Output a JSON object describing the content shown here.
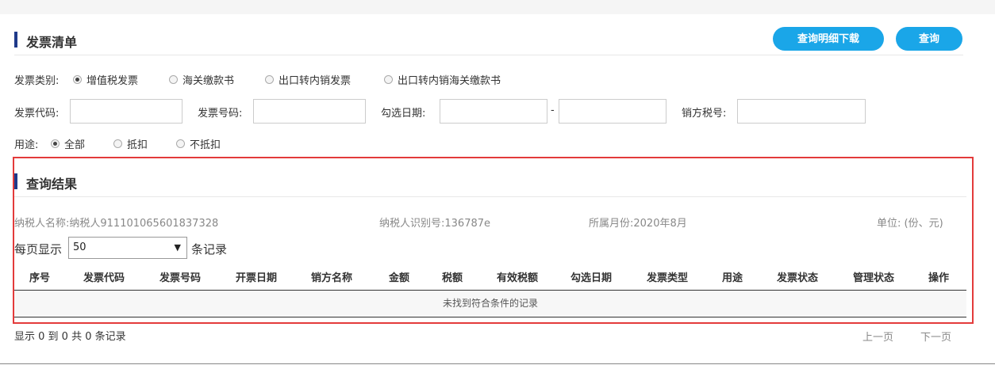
{
  "section_invoice": {
    "title": "发票清单"
  },
  "buttons": {
    "download": "查询明细下载",
    "query": "查询"
  },
  "invoice_type": {
    "label": "发票类别:",
    "options": [
      "增值税发票",
      "海关缴款书",
      "出口转内销发票",
      "出口转内销海关缴款书"
    ],
    "selected": 0
  },
  "filters": {
    "code_label": "发票代码:",
    "number_label": "发票号码:",
    "date_label": "勾选日期:",
    "date_sep": "-",
    "seller_tax_label": "销方税号:"
  },
  "usage": {
    "label": "用途:",
    "options": [
      "全部",
      "抵扣",
      "不抵扣"
    ],
    "selected": 0
  },
  "section_result": {
    "title": "查询结果"
  },
  "result_info": {
    "taxpayer_name": "纳税人名称:纳税人911101065601837328",
    "taxpayer_id": "纳税人识别号:136787e",
    "period": "所属月份:2020年8月",
    "unit": "单位: (份、元)"
  },
  "page_size": {
    "prefix": "每页显示",
    "value": "50",
    "suffix": "条记录"
  },
  "table": {
    "headers": [
      "序号",
      "发票代码",
      "发票号码",
      "开票日期",
      "销方名称",
      "金额",
      "税额",
      "有效税额",
      "勾选日期",
      "发票类型",
      "用途",
      "发票状态",
      "管理状态",
      "操作"
    ],
    "empty_text": "未找到符合条件的记录"
  },
  "footer": {
    "summary": "显示 0 到 0 共 0 条记录",
    "prev": "上一页",
    "next": "下一页"
  }
}
